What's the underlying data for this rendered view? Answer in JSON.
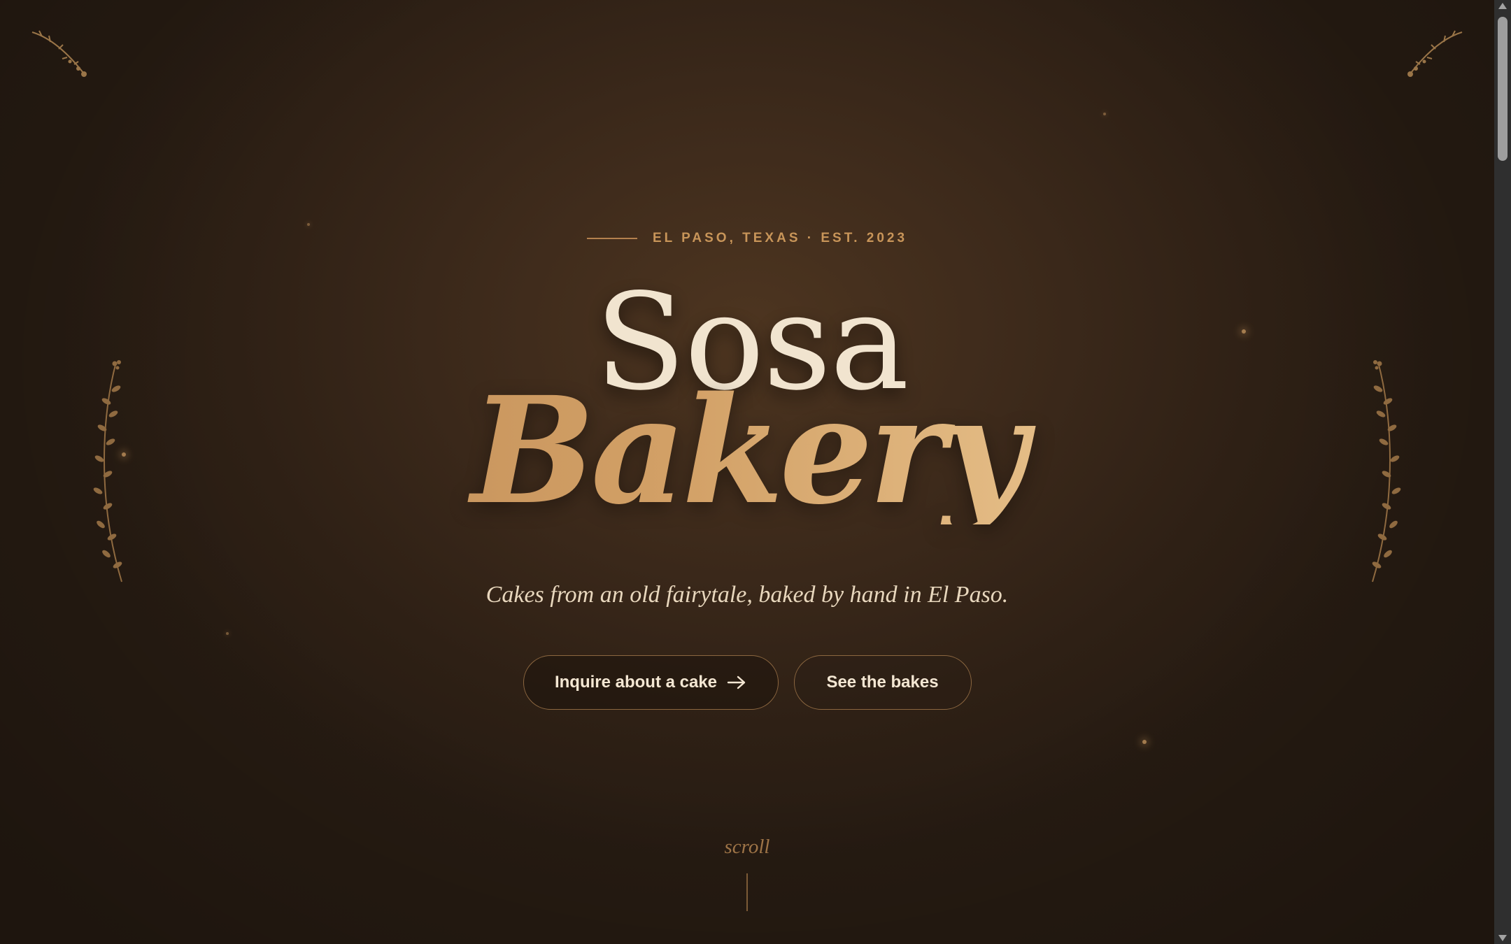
{
  "hero": {
    "eyebrow": "EL PASO, TEXAS · EST. 2023",
    "title_line1": "Sosa",
    "title_line2": "Bakery",
    "tagline": "Cakes from an old fairytale, baked by hand in El Paso.",
    "cta_primary": {
      "label": "Inquire about a cake",
      "icon": "arrow-right-icon"
    },
    "cta_secondary": {
      "label": "See the bakes"
    },
    "scroll_hint": "scroll"
  },
  "decorations": {
    "corner_icons": [
      "sprig-top-left-icon",
      "sprig-top-right-icon"
    ],
    "side_icons": [
      "laurel-left-icon",
      "laurel-right-icon"
    ]
  },
  "colors": {
    "background": "#3d2a1b",
    "accent_gold": "#c89559",
    "title_cream": "#f1e4cf",
    "button_border": "#8c6740"
  }
}
